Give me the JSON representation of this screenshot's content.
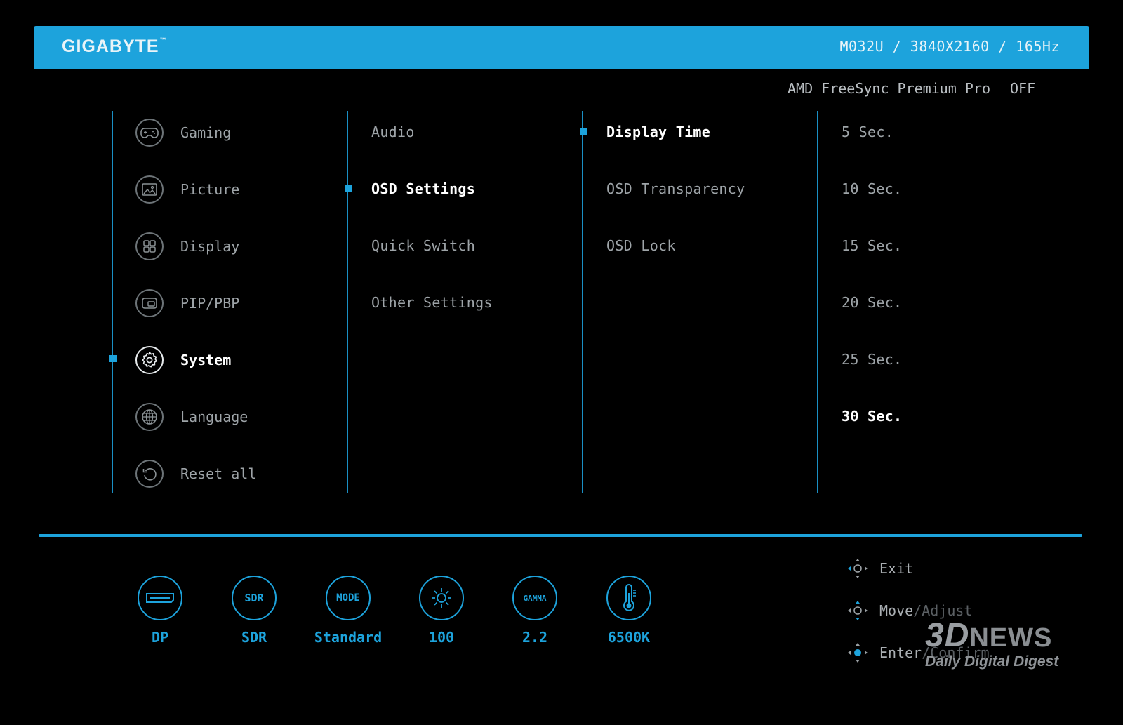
{
  "header": {
    "brand": "GIGABYTE",
    "brand_mark": "™",
    "model_info": "M032U  /  3840X2160  /  165Hz"
  },
  "status": {
    "freesync_label": "AMD FreeSync Premium Pro",
    "freesync_value": "OFF"
  },
  "main_menu": {
    "selected_index": 4,
    "items": [
      {
        "label": "Gaming",
        "icon": "gamepad-icon"
      },
      {
        "label": "Picture",
        "icon": "picture-icon"
      },
      {
        "label": "Display",
        "icon": "grid-icon"
      },
      {
        "label": "PIP/PBP",
        "icon": "pip-icon"
      },
      {
        "label": "System",
        "icon": "gear-icon"
      },
      {
        "label": "Language",
        "icon": "globe-icon"
      },
      {
        "label": "Reset all",
        "icon": "reset-icon"
      }
    ]
  },
  "sub_menu": {
    "selected_index": 1,
    "items": [
      {
        "label": "Audio"
      },
      {
        "label": "OSD Settings"
      },
      {
        "label": "Quick Switch"
      },
      {
        "label": "Other Settings"
      }
    ]
  },
  "settings_menu": {
    "selected_index": 0,
    "items": [
      {
        "label": "Display Time"
      },
      {
        "label": "OSD Transparency"
      },
      {
        "label": "OSD Lock"
      }
    ]
  },
  "options": {
    "selected_index": 5,
    "items": [
      {
        "label": "5 Sec."
      },
      {
        "label": "10 Sec."
      },
      {
        "label": "15 Sec."
      },
      {
        "label": "20 Sec."
      },
      {
        "label": "25 Sec."
      },
      {
        "label": "30 Sec."
      }
    ]
  },
  "status_bar": [
    {
      "icon": "displayport-icon",
      "icon_text": "",
      "value": "DP"
    },
    {
      "icon": "sdr-icon",
      "icon_text": "SDR",
      "value": "SDR"
    },
    {
      "icon": "mode-icon",
      "icon_text": "MODE",
      "value": "Standard"
    },
    {
      "icon": "brightness-icon",
      "icon_text": "",
      "value": "100"
    },
    {
      "icon": "gamma-icon",
      "icon_text": "GAMMA",
      "value": "2.2"
    },
    {
      "icon": "thermometer-icon",
      "icon_text": "",
      "value": "6500K"
    }
  ],
  "hints": {
    "exit": "Exit",
    "move": "Move",
    "move_sep": " / ",
    "adjust": "Adjust",
    "enter": "Enter",
    "enter_sep": " / ",
    "confirm": "Confirm"
  },
  "watermark": {
    "brand": "3DNEWS",
    "brand_prefix": "3D",
    "brand_suffix": "NEWS",
    "tagline": "Daily Digital Digest"
  },
  "colors": {
    "accent": "#1da3dc",
    "background": "#000000",
    "text_dim": "#9ea4a8"
  }
}
